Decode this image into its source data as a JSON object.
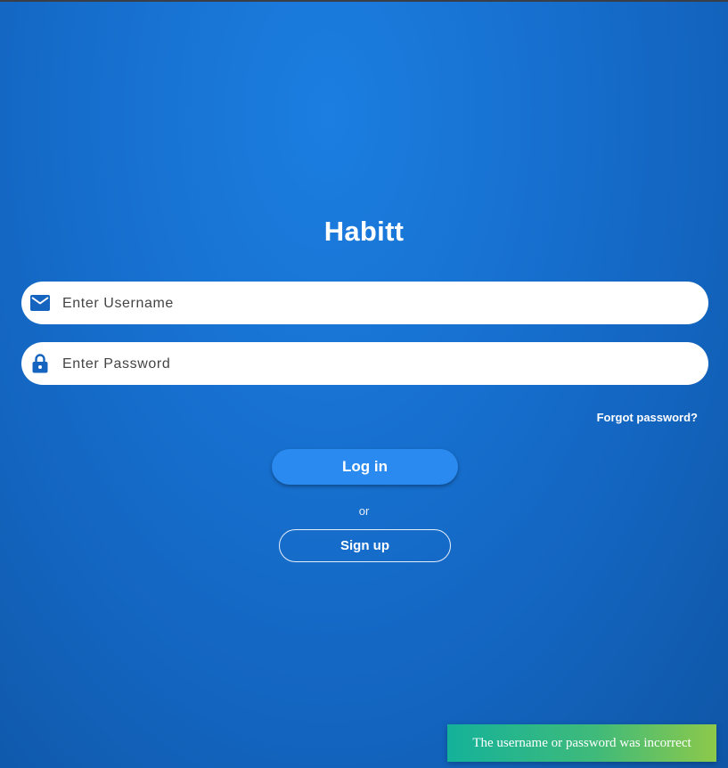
{
  "app": {
    "title": "Habitt"
  },
  "form": {
    "username": {
      "placeholder": "Enter Username",
      "value": "",
      "icon": "mail-icon"
    },
    "password": {
      "placeholder": "Enter Password",
      "value": "",
      "icon": "lock-icon"
    },
    "forgot_label": "Forgot password?",
    "login_label": "Log in",
    "or_label": "or",
    "signup_label": "Sign up"
  },
  "toast": {
    "message": "The username or password was incorrect"
  },
  "colors": {
    "background_top": "#1b7ee0",
    "background_bottom": "#0f56a6",
    "accent": "#1565c0",
    "login_button": "#2a8af0",
    "toast_start": "#14b29a",
    "toast_end": "#8dc94a"
  }
}
